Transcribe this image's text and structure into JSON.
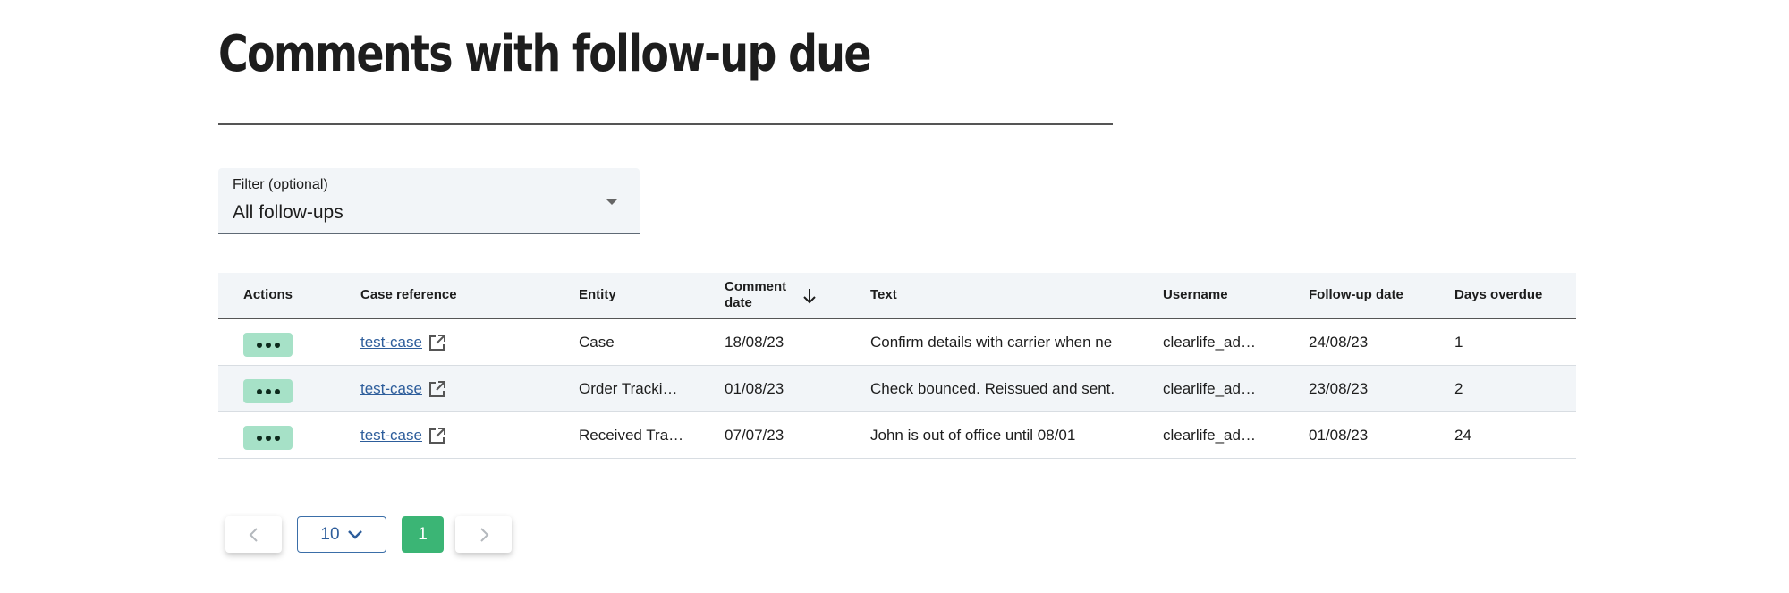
{
  "page": {
    "title": "Comments with follow-up due"
  },
  "filter": {
    "label": "Filter (optional)",
    "value": "All follow-ups",
    "icon": "caret-down-icon"
  },
  "table": {
    "headers": {
      "actions": "Actions",
      "case_reference": "Case reference",
      "entity": "Entity",
      "comment_date_line1": "Comment",
      "comment_date_line2": "date",
      "text": "Text",
      "username": "Username",
      "followup_date": "Follow-up date",
      "days_overdue": "Days overdue"
    },
    "sort": {
      "column": "comment_date",
      "direction": "descending",
      "icon": "arrow-down-icon"
    },
    "rows": [
      {
        "case_reference": "test-case",
        "entity": "Case",
        "comment_date": "18/08/23",
        "text": "Confirm details with carrier when ne",
        "username": "clearlife_ad…",
        "followup_date": "24/08/23",
        "days_overdue": "1"
      },
      {
        "case_reference": "test-case",
        "entity": "Order Tracki…",
        "comment_date": "01/08/23",
        "text": "Check bounced. Reissued and sent.",
        "username": "clearlife_ad…",
        "followup_date": "23/08/23",
        "days_overdue": "2"
      },
      {
        "case_reference": "test-case",
        "entity": "Received Tra…",
        "comment_date": "07/07/23",
        "text": "John is out of office until 08/01",
        "username": "clearlife_ad…",
        "followup_date": "01/08/23",
        "days_overdue": "24"
      }
    ]
  },
  "pagination": {
    "page_size": "10",
    "current_page": "1",
    "prev_icon": "chevron-left-icon",
    "next_icon": "chevron-right-icon",
    "page_size_icon": "chevron-down-icon"
  },
  "colors": {
    "action_button": "#a6e1c7",
    "link": "#2d5d9b",
    "active_page": "#3bb575",
    "header_bg": "#f2f5f8"
  }
}
